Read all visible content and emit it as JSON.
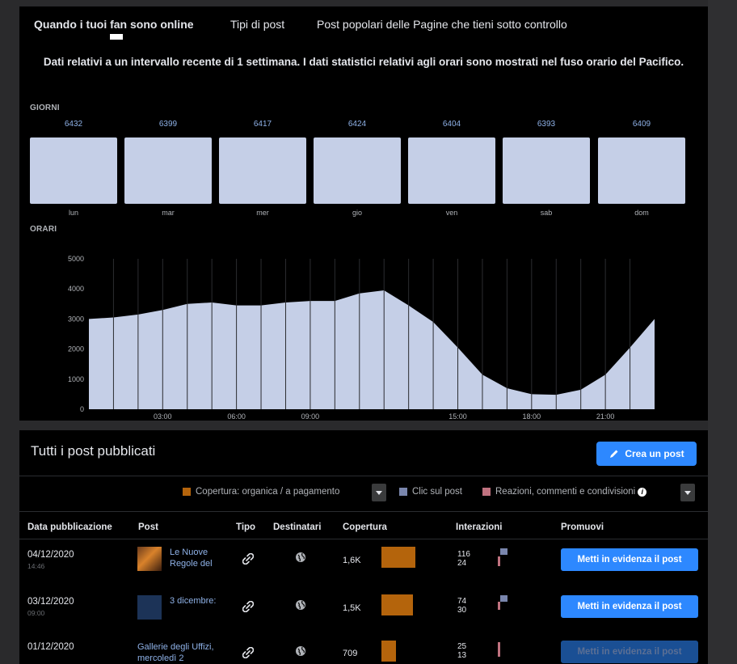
{
  "tabs": [
    "Quando i tuoi fan sono online",
    "Tipi di post",
    "Post popolari delle Pagine che tieni sotto controllo"
  ],
  "notice": "Dati relativi a un intervallo recente di 1 settimana. I dati statistici relativi agli orari sono mostrati nel fuso orario del Pacifico.",
  "days_label": "GIORNI",
  "days": [
    {
      "label": "lun",
      "value": "6432"
    },
    {
      "label": "mar",
      "value": "6399"
    },
    {
      "label": "mer",
      "value": "6417"
    },
    {
      "label": "gio",
      "value": "6424"
    },
    {
      "label": "ven",
      "value": "6404"
    },
    {
      "label": "sab",
      "value": "6393"
    },
    {
      "label": "dom",
      "value": "6409"
    }
  ],
  "hours_label": "ORARI",
  "chart_data": {
    "type": "area",
    "x_ticks": [
      "03:00",
      "06:00",
      "09:00",
      "15:00",
      "18:00",
      "21:00"
    ],
    "x": [
      0,
      1,
      2,
      3,
      4,
      5,
      6,
      7,
      8,
      9,
      10,
      11,
      12,
      13,
      14,
      15,
      16,
      17,
      18,
      19,
      20,
      21,
      22,
      23
    ],
    "values": [
      3000,
      3050,
      3150,
      3300,
      3500,
      3550,
      3450,
      3450,
      3550,
      3600,
      3600,
      3850,
      3950,
      3450,
      2900,
      2050,
      1150,
      700,
      500,
      480,
      650,
      1150,
      2050,
      3000
    ],
    "y_ticks": [
      0,
      1000,
      2000,
      3000,
      4000,
      5000
    ],
    "ylim": [
      0,
      5000
    ],
    "color": "#c5cfe7"
  },
  "posts_title": "Tutti i post pubblicati",
  "create_post": "Crea un post",
  "legend": {
    "coverage": "Copertura: organica / a pagamento",
    "clicks": "Clic sul post",
    "reactions": "Reazioni, commenti e condivisioni",
    "colors": {
      "coverage": "#b4640c",
      "clicks": "#7a86ad",
      "reactions": "#c0727f"
    }
  },
  "columns": [
    "Data pubblicazione",
    "Post",
    "Tipo",
    "Destinatari",
    "Copertura",
    "Interazioni",
    "Promuovi"
  ],
  "rows": [
    {
      "date": "04/12/2020",
      "time": "14:46",
      "post": "Le Nuove Regole del",
      "reach": "1,6K",
      "reach_level": 1.0,
      "inter1": "116",
      "inter2": "24",
      "promote": "Metti in evidenza il post"
    },
    {
      "date": "03/12/2020",
      "time": "09:00",
      "post": "3 dicembre:",
      "reach": "1,5K",
      "reach_level": 0.93,
      "inter1": "74",
      "inter2": "30",
      "promote": "Metti in evidenza il post"
    },
    {
      "date": "01/12/2020",
      "time": "",
      "post": "Gallerie degli Uffizi, mercoledì 2",
      "reach": "709",
      "reach_level": 0.44,
      "inter1": "25",
      "inter2": "13",
      "promote": "Metti in evidenza il post"
    }
  ]
}
